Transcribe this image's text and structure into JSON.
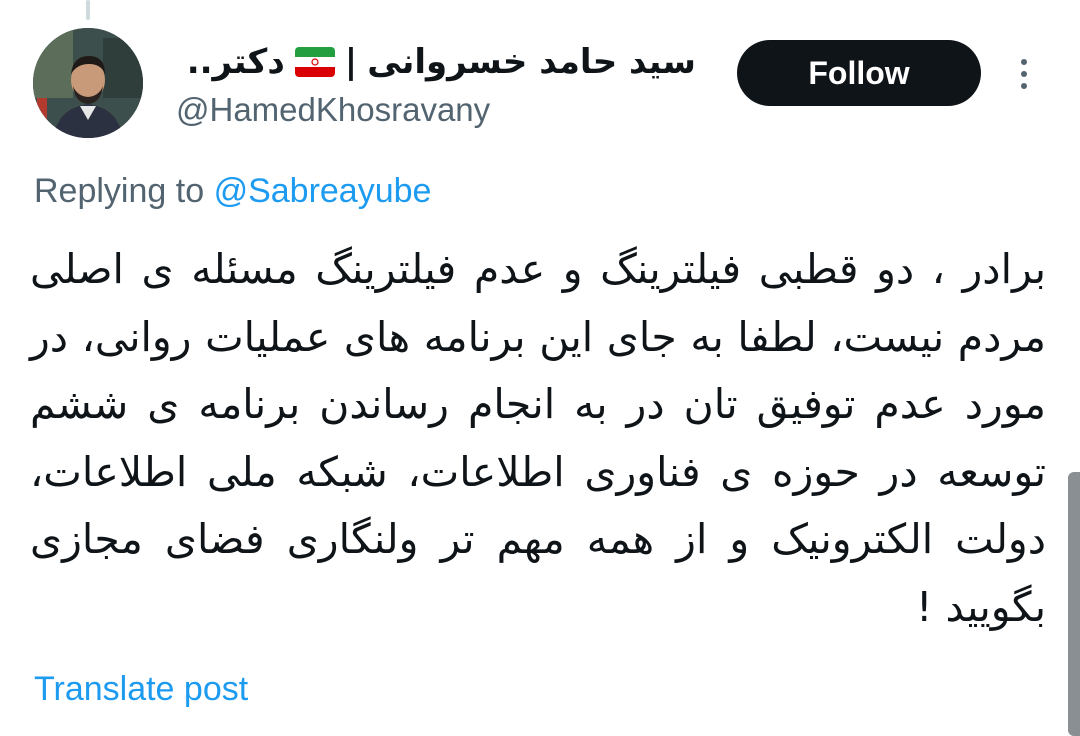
{
  "author": {
    "display_name_part1": "سید حامد خسروانی",
    "display_name_separator": "|",
    "display_name_part2": "دکتر..",
    "flag_icon": "iran-flag-icon",
    "handle": "@HamedKhosravany"
  },
  "actions": {
    "follow_label": "Follow",
    "more_icon": "more-vertical-icon"
  },
  "reply_context": {
    "prefix": "Replying to",
    "mention": "@Sabreayube"
  },
  "tweet": {
    "text": "برادر ، دو قطبی فیلترینگ و عدم فیلترینگ مسئله ی اصلی مردم نیست، لطفا به جای این برنامه های عملیات روانی، در مورد عدم توفیق تان در به انجام رساندن برنامه ی ششم توسعه در حوزه ی فناوری اطلاعات، شبکه ملی اطلاعات، دولت الکترونیک و از همه مهم تر ولنگاری فضای مجازی بگویید !"
  },
  "footer": {
    "translate_label": "Translate post"
  },
  "colors": {
    "text_primary": "#0f1419",
    "text_secondary": "#536471",
    "link": "#1d9bf0",
    "button_bg": "#0f1419",
    "button_text": "#ffffff"
  }
}
